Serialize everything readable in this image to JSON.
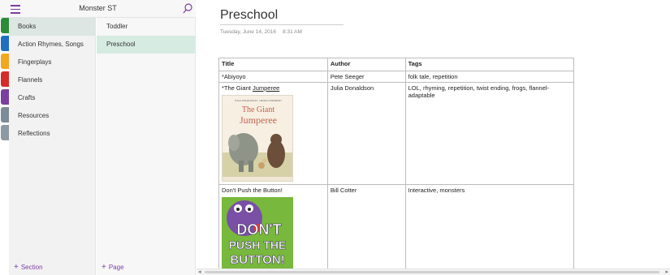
{
  "notebook": {
    "title": "Monster ST"
  },
  "colors": {
    "accent": "#7b3fa0",
    "selected_section": "#dde6e2",
    "selected_page": "#d6ebe2"
  },
  "icons": {
    "menu": "hamburger-icon",
    "search": "search-icon"
  },
  "section_tabs": [
    {
      "color": "#2e8b3a"
    },
    {
      "color": "#1f6fc1"
    },
    {
      "color": "#f2a81d"
    },
    {
      "color": "#d62b2b"
    },
    {
      "color": "#7b3fa0"
    },
    {
      "color": "#7d8b96"
    },
    {
      "color": "#8e9aa3"
    }
  ],
  "sections": [
    {
      "label": "Books",
      "selected": true
    },
    {
      "label": "Action Rhymes, Songs"
    },
    {
      "label": "Fingerplays"
    },
    {
      "label": "Flannels"
    },
    {
      "label": "Crafts"
    },
    {
      "label": "Resources"
    },
    {
      "label": "Reflections"
    }
  ],
  "pages": [
    {
      "label": "Toddler"
    },
    {
      "label": "Preschool",
      "selected": true
    }
  ],
  "add_section_label": "Section",
  "add_page_label": "Page",
  "page": {
    "title": "Preschool",
    "date": "Tuesday, June 14, 2016",
    "time": "8:31 AM"
  },
  "table": {
    "headers": {
      "title": "Title",
      "author": "Author",
      "tags": "Tags"
    },
    "rows": [
      {
        "title": "*Abiyoyo",
        "author": "Pete Seeger",
        "tags": "folk tale, repetition"
      },
      {
        "title_prefix": "*The Giant ",
        "title_underlined": "Jumperee",
        "author": "Julia Donaldson",
        "tags": "LOL, rhyming, repetition, twist ending, frogs, flannel-adaptable",
        "cover": {
          "authors_line": "JULIA DONALDSON · HELEN OXENBURY",
          "title_line1": "The Giant",
          "title_line2": "Jumperee"
        }
      },
      {
        "title": "Don't Push the Button!",
        "author": "Bill Cotter",
        "tags": "Interactive, monsters",
        "cover": {
          "line1": "DON'T",
          "line2": "PUSH THE",
          "line3": "BUTTON!"
        }
      }
    ]
  }
}
